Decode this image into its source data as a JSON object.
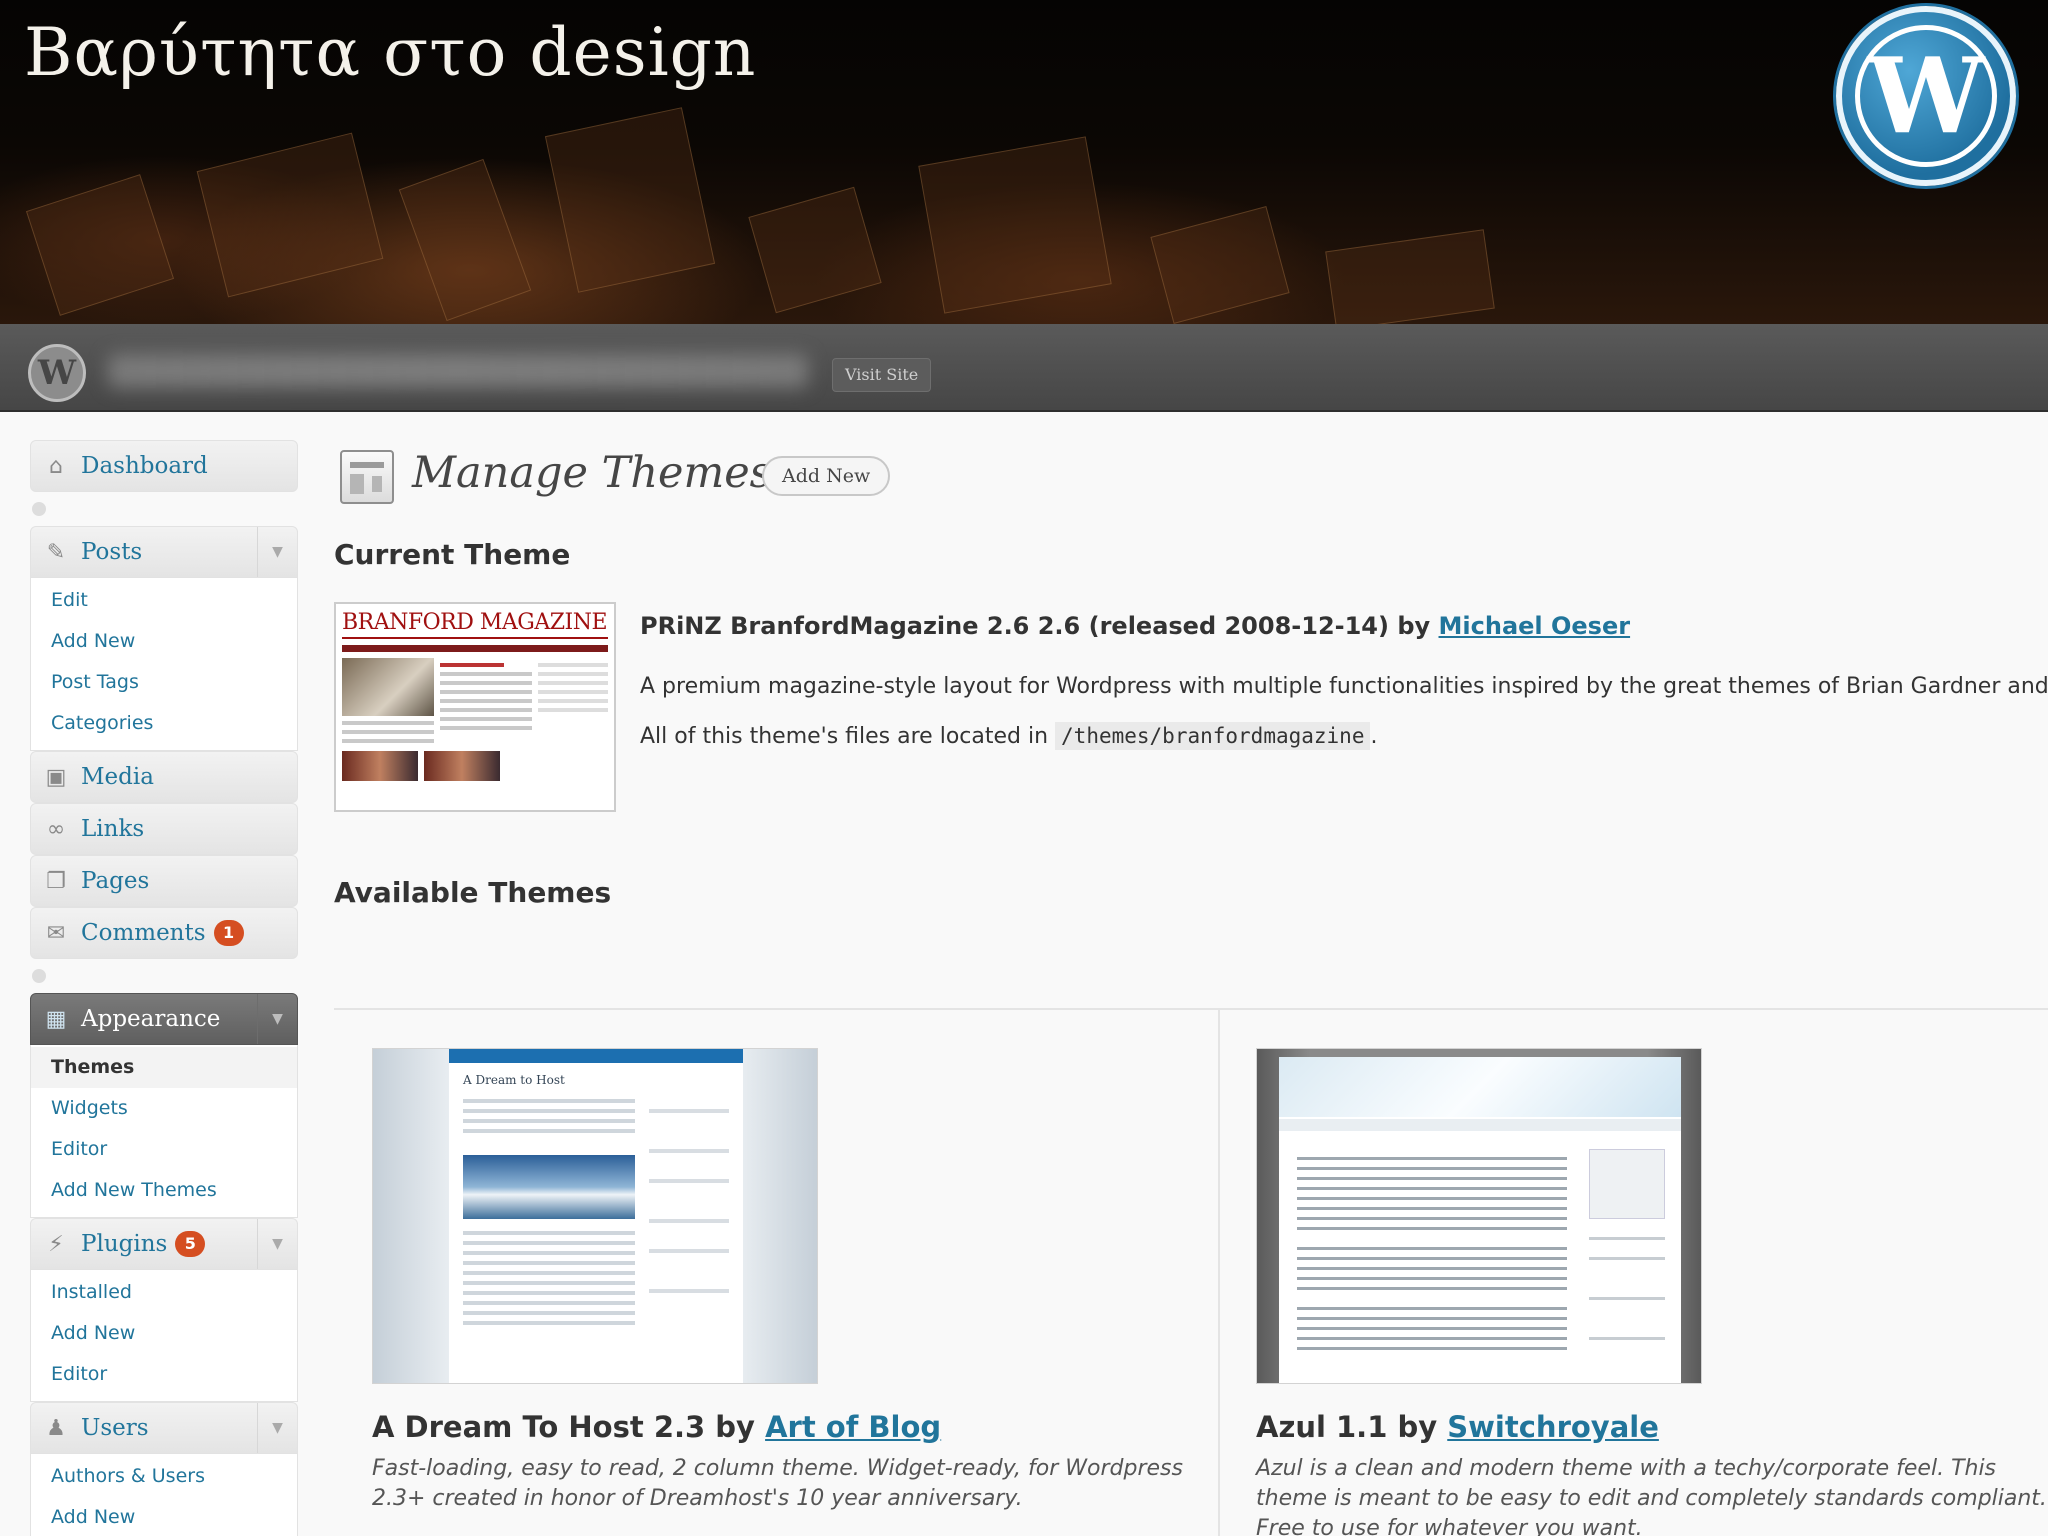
{
  "slide": {
    "title": "Βαρύτητα στο design"
  },
  "adminbar": {
    "visit_site": "Visit Site"
  },
  "sidebar": {
    "dashboard": "Dashboard",
    "posts": {
      "label": "Posts",
      "items": [
        "Edit",
        "Add New",
        "Post Tags",
        "Categories"
      ]
    },
    "media": "Media",
    "links": "Links",
    "pages": "Pages",
    "comments": {
      "label": "Comments",
      "badge": "1"
    },
    "appearance": {
      "label": "Appearance",
      "items": [
        "Themes",
        "Widgets",
        "Editor",
        "Add New Themes"
      ]
    },
    "plugins": {
      "label": "Plugins",
      "badge": "5",
      "items": [
        "Installed",
        "Add New",
        "Editor"
      ]
    },
    "users": {
      "label": "Users",
      "items": [
        "Authors & Users",
        "Add New"
      ]
    }
  },
  "main": {
    "title": "Manage Themes",
    "add_new": "Add New",
    "current_heading": "Current Theme",
    "current_theme": {
      "screenshot_header": "BRANFORD MAGAZINE",
      "title": "PRiNZ BranfordMagazine 2.6 2.6 (released 2008-12-14) by",
      "author": "Michael Oeser",
      "description": "A premium magazine-style layout for Wordpress with multiple functionalities inspired by the great themes of Brian Gardner and",
      "location_prefix": "All of this theme's files are located in",
      "location_path": "/themes/branfordmagazine",
      "location_suffix": "."
    },
    "available_heading": "Available Themes",
    "themes": [
      {
        "name": "A Dream To Host 2.3 by",
        "author": "Art of Blog",
        "description": "Fast-loading, easy to read, 2 column theme. Widget-ready, for Wordpress 2.3+ created in honor of Dreamhost's 10 year anniversary.",
        "preview_title": "A Dream to Host"
      },
      {
        "name": "Azul 1.1 by",
        "author": "Switchroyale",
        "description": "Azul is a clean and modern theme with a techy/corporate feel. This theme is meant to be easy to edit and completely standards compliant. Free to use for whatever you want."
      }
    ]
  },
  "colors": {
    "link": "#21759b",
    "badge": "#d54e21",
    "adminbar": "#464646"
  }
}
